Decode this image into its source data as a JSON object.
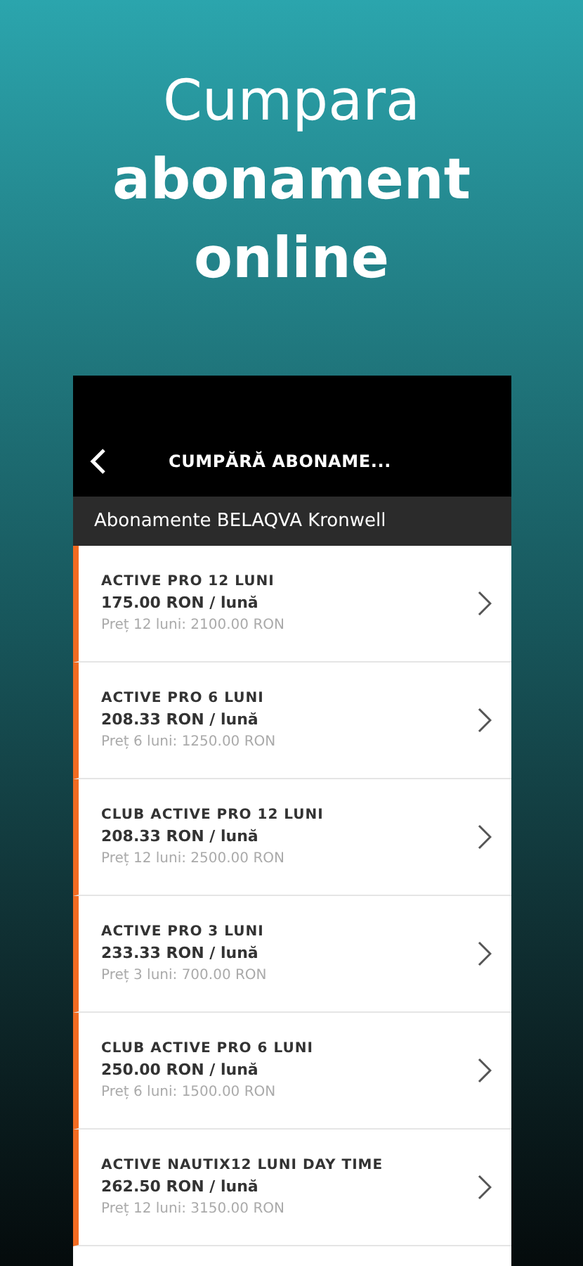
{
  "headline": [
    {
      "text": "Cumpara",
      "bold": false
    },
    {
      "text": "abonament",
      "bold": true
    },
    {
      "text": "online",
      "bold": true
    }
  ],
  "screen": {
    "title": "CUMPĂRĂ ABONAME...",
    "section": "Abonamente BELAQVA Kronwell",
    "items": [
      {
        "name": "ACTIVE PRO 12 LUNI",
        "price": "175.00 RON / lună",
        "total": "Preț 12 luni: 2100.00 RON"
      },
      {
        "name": "ACTIVE PRO 6 LUNI",
        "price": "208.33 RON / lună",
        "total": "Preț 6 luni: 1250.00 RON"
      },
      {
        "name": "CLUB ACTIVE PRO 12 LUNI",
        "price": "208.33 RON / lună",
        "total": "Preț 12 luni: 2500.00 RON"
      },
      {
        "name": "ACTIVE PRO 3 LUNI",
        "price": "233.33 RON / lună",
        "total": "Preț 3 luni: 700.00 RON"
      },
      {
        "name": "CLUB ACTIVE PRO 6 LUNI",
        "price": "250.00 RON / lună",
        "total": "Preț 6 luni: 1500.00 RON"
      },
      {
        "name": "ACTIVE NAUTIX12 LUNI DAY TIME",
        "price": "262.50 RON / lună",
        "total": "Preț 12 luni: 3150.00 RON"
      }
    ]
  }
}
